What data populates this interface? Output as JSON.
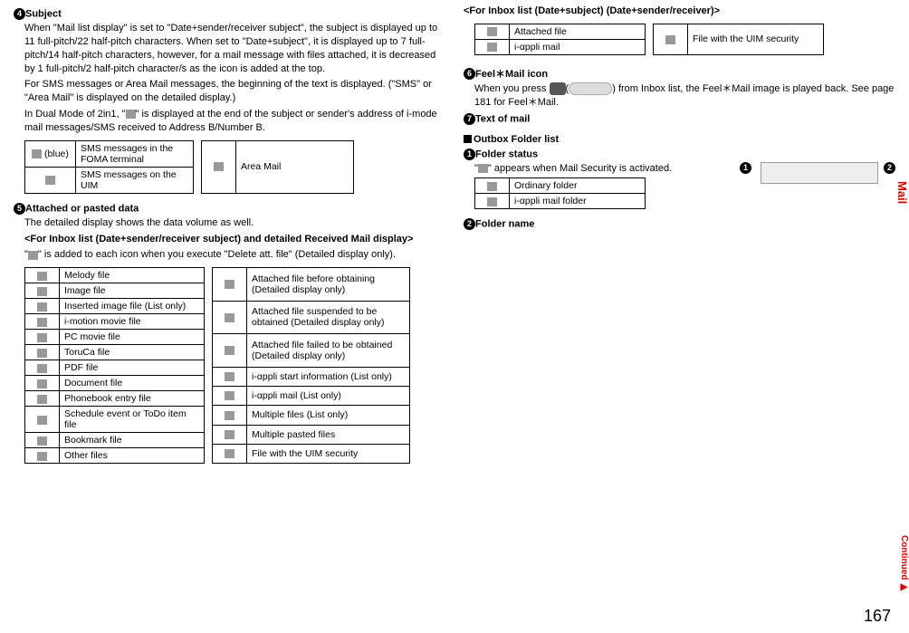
{
  "page_number": "167",
  "side_tab": "Mail",
  "continued": "Continued",
  "left": {
    "sec4_num": "4",
    "sec4_title": "Subject",
    "sec4_p1": "When \"Mail list display\" is set to \"Date+sender/receiver subject\", the subject is displayed up to 11 full-pitch/22 half-pitch characters. When set to \"Date+subject\", it is displayed up to 7 full-pitch/14 half-pitch characters, however, for a mail message with files attached, it is decreased by 1 full-pitch/2 half-pitch character/s as the icon is added at the top.",
    "sec4_p2": "For SMS messages or Area Mail messages, the beginning of the text is displayed. (\"SMS\" or \"Area Mail\" is displayed on the detailed display.)",
    "sec4_p3_a": "In Dual Mode of 2in1, \"",
    "sec4_p3_b": "\" is displayed at the end of the subject or sender's address of i-mode mail messages/SMS received to Address B/Number B.",
    "sms_table": {
      "r1_icon": "(blue)",
      "r1_text": "SMS messages in the FOMA terminal",
      "r2_text": "SMS messages on the UIM",
      "r1b_text": "Area Mail"
    },
    "sec5_num": "5",
    "sec5_title": "Attached or pasted data",
    "sec5_p1": "The detailed display shows the data volume as well.",
    "sec5_sub1": "<For Inbox list (Date+sender/receiver subject) and detailed Received Mail display>",
    "sec5_p2_a": "\"",
    "sec5_p2_b": "\" is added to each icon when you execute \"Delete att. file\" (Detailed display only).",
    "file_table_left": [
      "Melody file",
      "Image file",
      "Inserted image file (List only)",
      "i-motion movie file",
      "PC movie file",
      "ToruCa file",
      "PDF file",
      "Document file",
      "Phonebook entry file",
      "Schedule event or ToDo item file",
      "Bookmark file",
      "Other files"
    ],
    "file_table_right": [
      "Attached file before obtaining (Detailed display only)",
      "Attached file suspended to be obtained (Detailed display only)",
      "Attached file failed to be obtained (Detailed display only)",
      "i-αppli start information (List only)",
      "i-αppli mail (List only)",
      "Multiple files (List only)",
      "Multiple pasted files",
      "File with the UIM security"
    ]
  },
  "right": {
    "sub1": "<For Inbox list (Date+subject) (Date+sender/receiver)>",
    "inbox_table": {
      "r1a": "Attached file",
      "r1b": "File with the UIM security",
      "r2a": "i-αppli mail"
    },
    "sec6_num": "6",
    "sec6_title": "Feel＊Mail icon",
    "sec6_p1_a": "When you press ",
    "sec6_p1_b": "(",
    "sec6_p1_c": ") from Inbox list, the Feel＊Mail image is played back. See page 181 for Feel＊Mail.",
    "sec7_num": "7",
    "sec7_title": "Text of mail",
    "outbox_title": "Outbox Folder list",
    "o1_num": "1",
    "o1_title": "Folder status",
    "o1_p1_a": "\"",
    "o1_p1_b": "\" appears when Mail Security is activated.",
    "callout1": "1",
    "callout2": "2",
    "outbox_table": {
      "r1": "Ordinary folder",
      "r2": "i-αppli mail folder"
    },
    "o2_num": "2",
    "o2_title": "Folder name"
  }
}
